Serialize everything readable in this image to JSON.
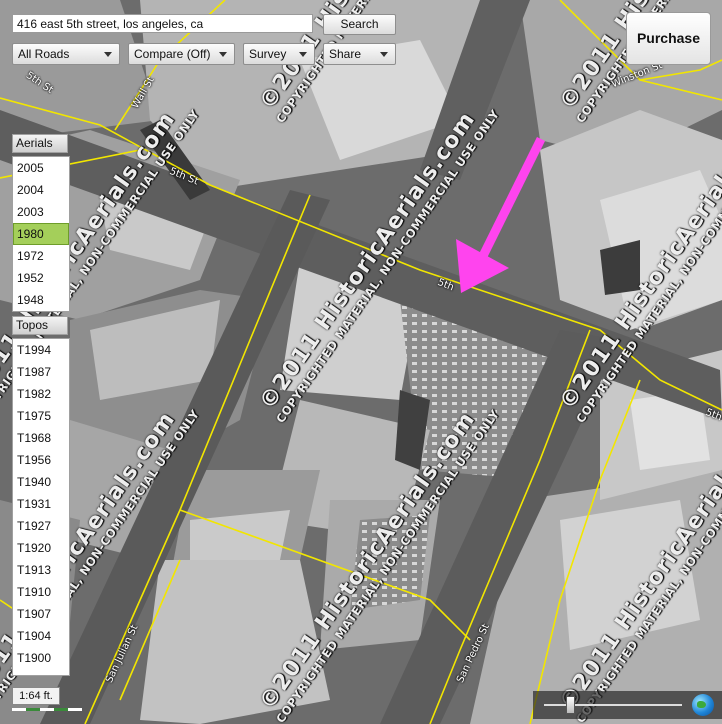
{
  "search": {
    "value": "416 east 5th street, los angeles, ca",
    "button_label": "Search"
  },
  "toolbar": {
    "roads_label": "All Roads",
    "compare_label": "Compare (Off)",
    "survey_label": "Survey",
    "share_label": "Share",
    "purchase_label": "Purchase"
  },
  "aerials": {
    "header": "Aerials",
    "years": [
      "2005",
      "2004",
      "2003",
      "1980",
      "1972",
      "1952",
      "1948"
    ],
    "selected": "1980"
  },
  "topos": {
    "header": "Topos",
    "years": [
      "T1994",
      "T1987",
      "T1982",
      "T1975",
      "T1968",
      "T1956",
      "T1940",
      "T1931",
      "T1927",
      "T1920",
      "T1913",
      "T1910",
      "T1907",
      "T1904",
      "T1900"
    ]
  },
  "scale": {
    "label": "1:64 ft."
  },
  "zoom": {
    "level": 0.2
  },
  "streets": {
    "s1": "5th St",
    "s2": "Wall St",
    "s3": "5th St",
    "s4": "5th St",
    "s5": "Winston St",
    "s6": "San Julian St",
    "s7": "San Pedro St",
    "s8": "5th"
  },
  "watermark": {
    "main": "©2011 HistoricAerials.com",
    "sub": "COPYRIGHTED MATERIAL, NON-COMMERCIAL USE ONLY"
  },
  "colors": {
    "road_line": "#f2e600",
    "arrow": "#ff44ee",
    "selected_year": "#a4cf5a"
  },
  "icons": {
    "globe": "globe-icon",
    "dropdown": "chevron-down-icon",
    "arrow": "pointer-arrow"
  }
}
